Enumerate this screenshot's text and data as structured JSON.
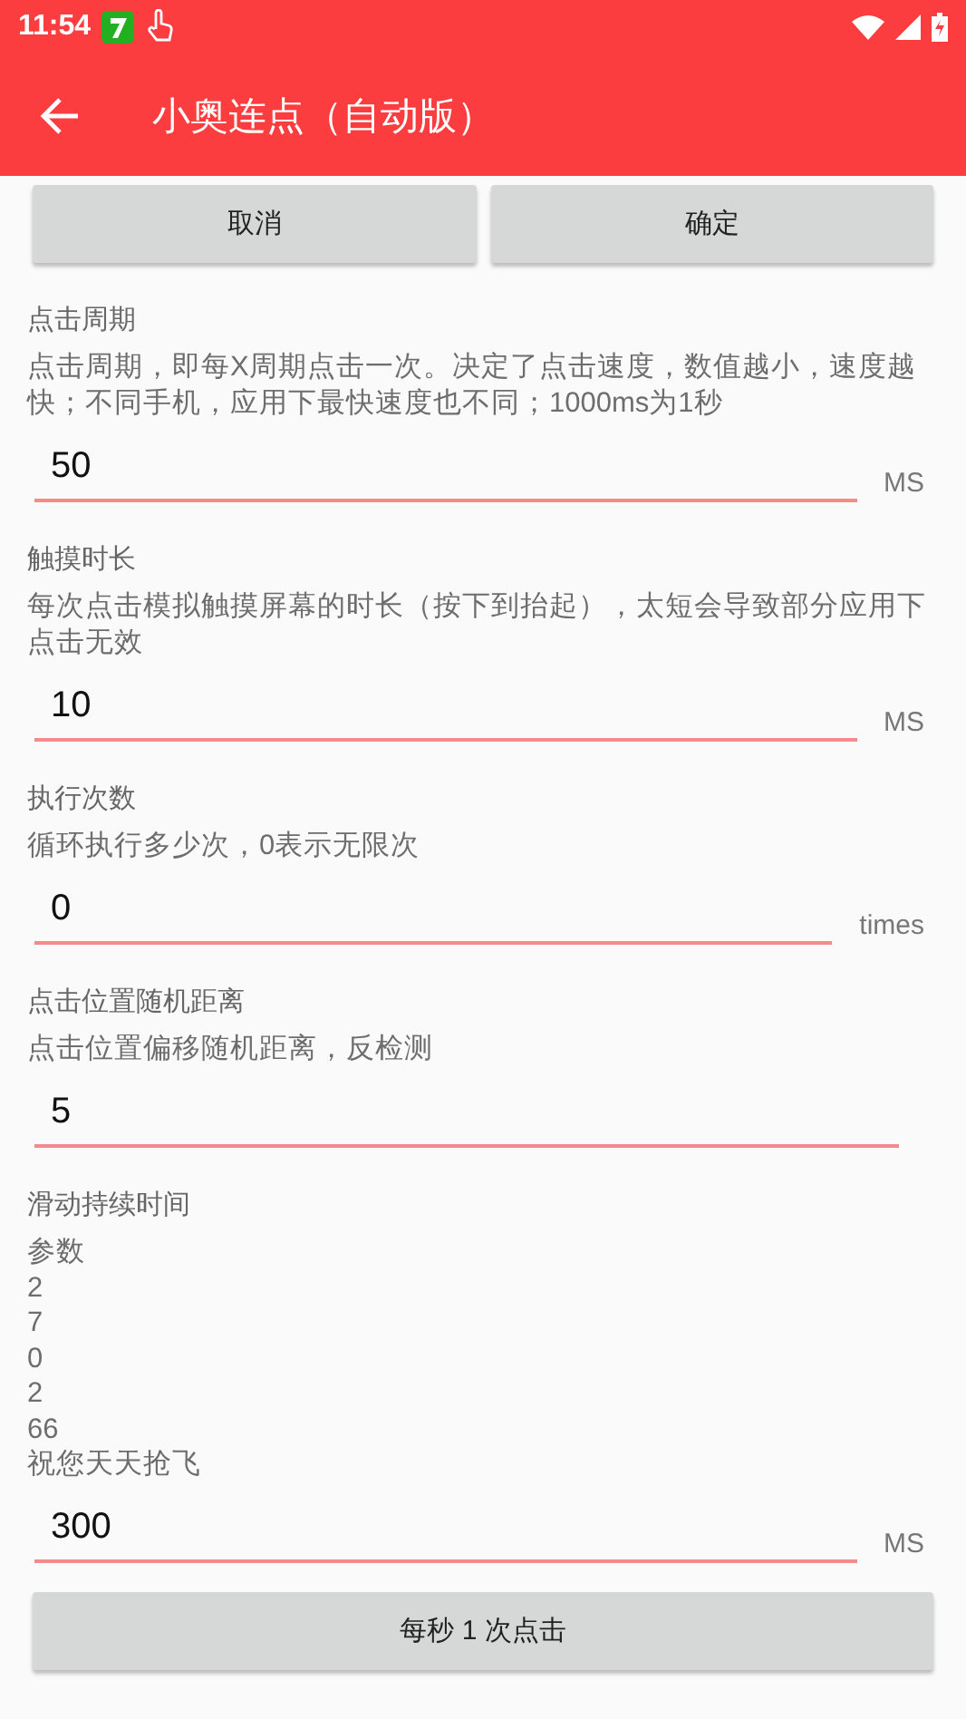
{
  "status_bar": {
    "time": "11:54"
  },
  "app_bar": {
    "title": "小奥连点（自动版）"
  },
  "top_buttons": [
    "取消",
    "确定"
  ],
  "settings": [
    {
      "title": "点击周期",
      "description": "点击周期，即每X周期点击一次。决定了点击速度，数值越小，速度越快；不同手机，应用下最快速度也不同；1000ms为1秒",
      "value": "50",
      "unit": "MS"
    },
    {
      "title": "触摸时长",
      "description": "每次点击模拟触摸屏幕的时长（按下到抬起），太短会导致部分应用下点击无效",
      "value": "10",
      "unit": "MS"
    },
    {
      "title": "执行次数",
      "description": "循环执行多少次，0表示无限次",
      "value": "0",
      "unit": "times"
    },
    {
      "title": "点击位置随机距离",
      "description": "点击位置偏移随机距离，反检测",
      "value": "5"
    },
    {
      "title": "滑动持续时间",
      "description": "参数\n2\n7\n0\n2\n66\n祝您天天抢飞",
      "value": "300",
      "unit": "MS"
    }
  ],
  "bottom_button": "每秒 1 次点击"
}
